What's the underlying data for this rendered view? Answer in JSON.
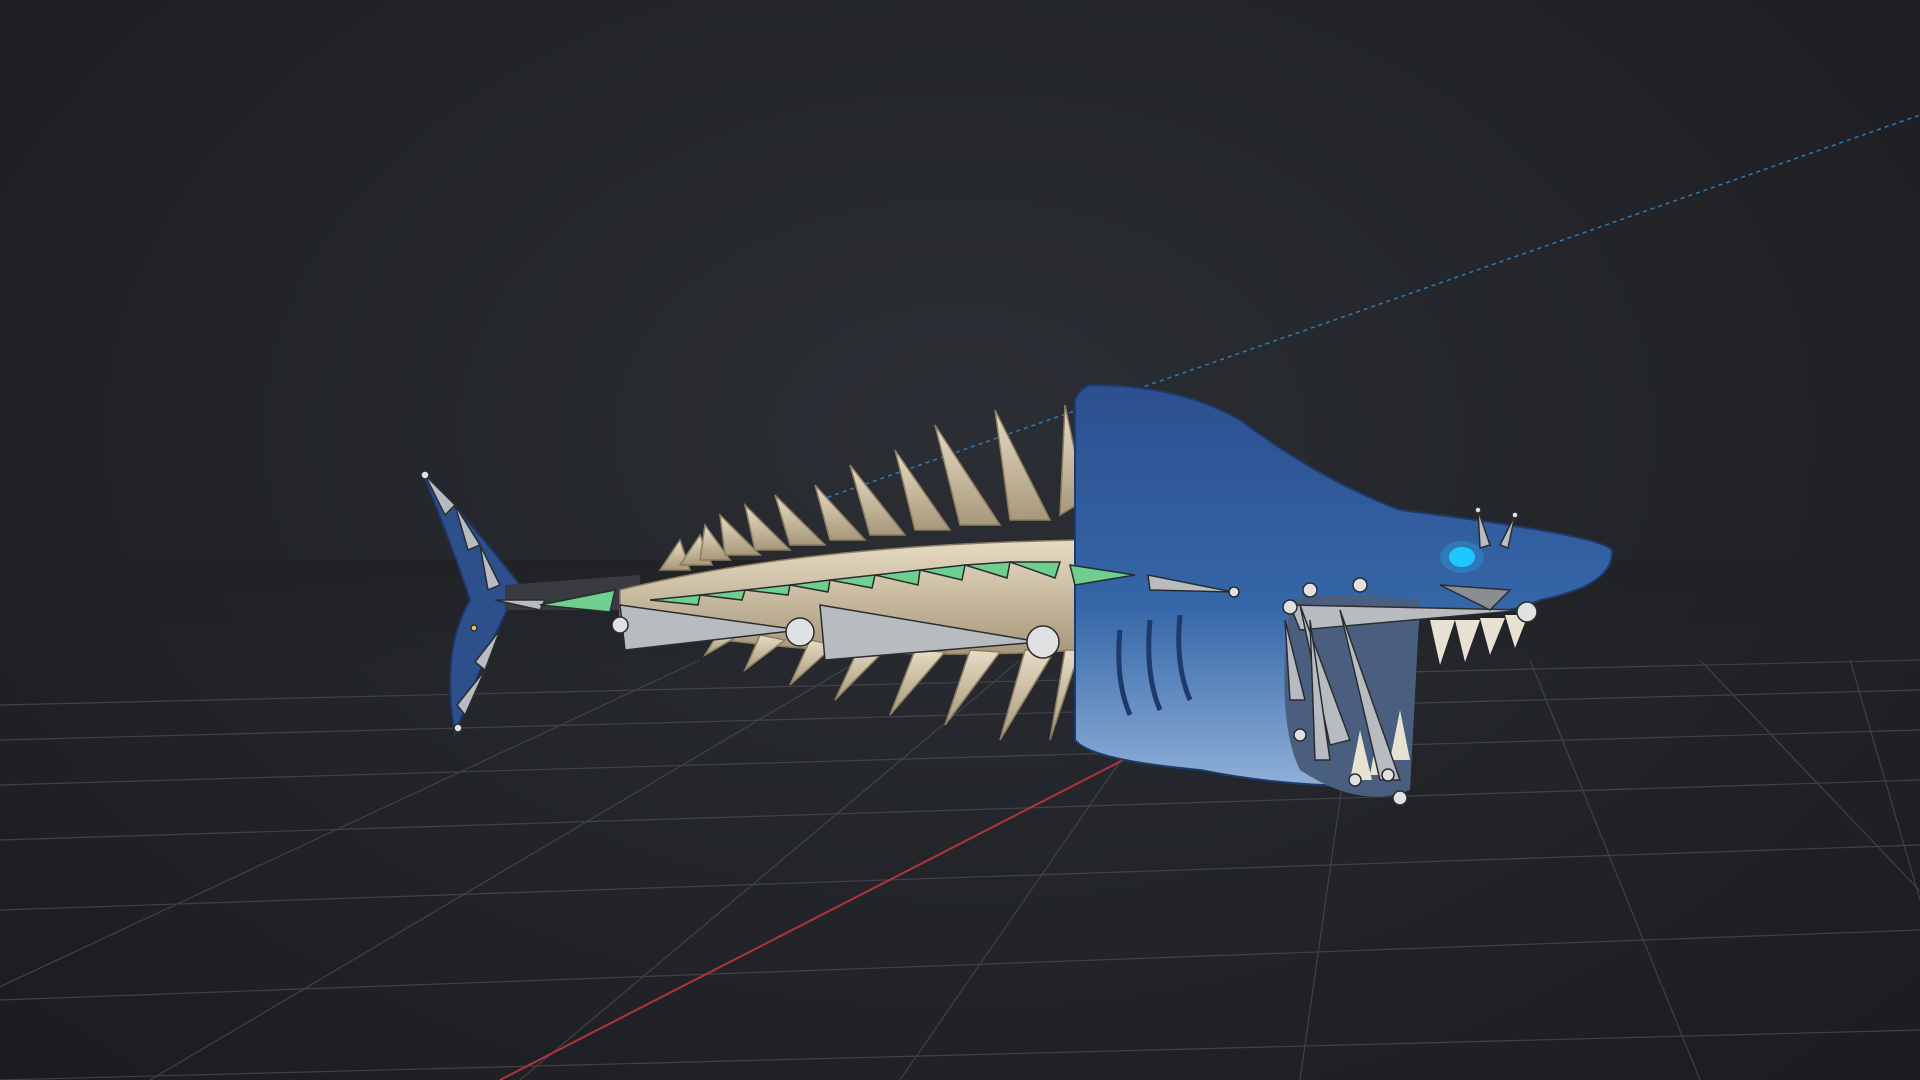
{
  "viewport": {
    "background": "#202226",
    "grid_color": "#4a4d52",
    "x_axis_color": "#b0343a",
    "y_axis_color": "#2e7bb7"
  },
  "colors": {
    "shark_skin": "#2f5a9a",
    "shark_belly": "#8fb3d9",
    "bone": "#d9ccb0",
    "bone_shadow": "#a99a7c",
    "armature_bone": "#b8bcc0",
    "armature_active": "#6fcf8f",
    "eye_glow": "#1ec8ff"
  },
  "objects": [
    {
      "name": "shark-head",
      "type": "mesh"
    },
    {
      "name": "shark-skeleton",
      "type": "mesh"
    },
    {
      "name": "shark-tail",
      "type": "mesh"
    },
    {
      "name": "armature",
      "type": "armature"
    }
  ]
}
